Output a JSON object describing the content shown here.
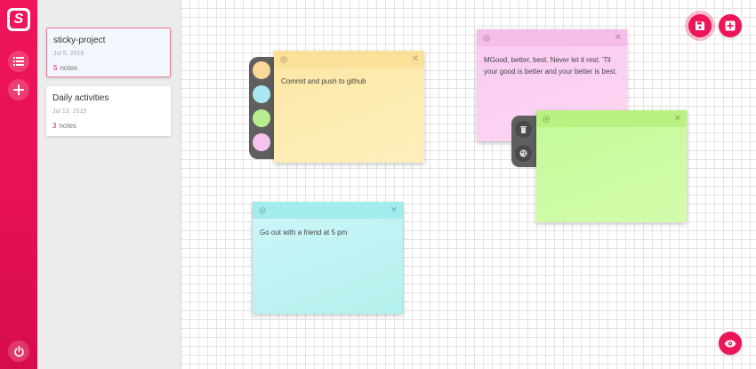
{
  "app": {
    "logo_letter": "S",
    "accent": "#ec1558"
  },
  "sidebar": {
    "icons": [
      "list-icon",
      "plus-icon",
      "power-icon"
    ]
  },
  "projects": [
    {
      "title": "sticky-project",
      "date": "Jul 5, 2019",
      "count": "5",
      "count_label": "notes",
      "active": true
    },
    {
      "title": "Daily activities",
      "date": "Jul 13, 2019",
      "count": "3",
      "count_label": "notes",
      "active": false
    }
  ],
  "notes": [
    {
      "text": "Commit and push to github",
      "color": "#fdecaa",
      "header_color": "#fbe29b"
    },
    {
      "text": "MGood, better, best. Never let it rest. 'Til your good is better and your better is best.",
      "color": "#fbd3f2",
      "header_color": "#f6c4ea"
    },
    {
      "text": "",
      "color": "#ccfb9f",
      "header_color": "#bdf585"
    },
    {
      "text": "Go out with a friend at 5 pm",
      "color": "#c9f5f6",
      "header_color": "#a7eef0"
    }
  ],
  "palette_colors": [
    "#fbd899",
    "#a9e8f3",
    "#b7ee90",
    "#f6c4ef"
  ],
  "toolbar": {
    "icons": [
      "save-icon",
      "add-note-icon",
      "eye-icon"
    ]
  }
}
